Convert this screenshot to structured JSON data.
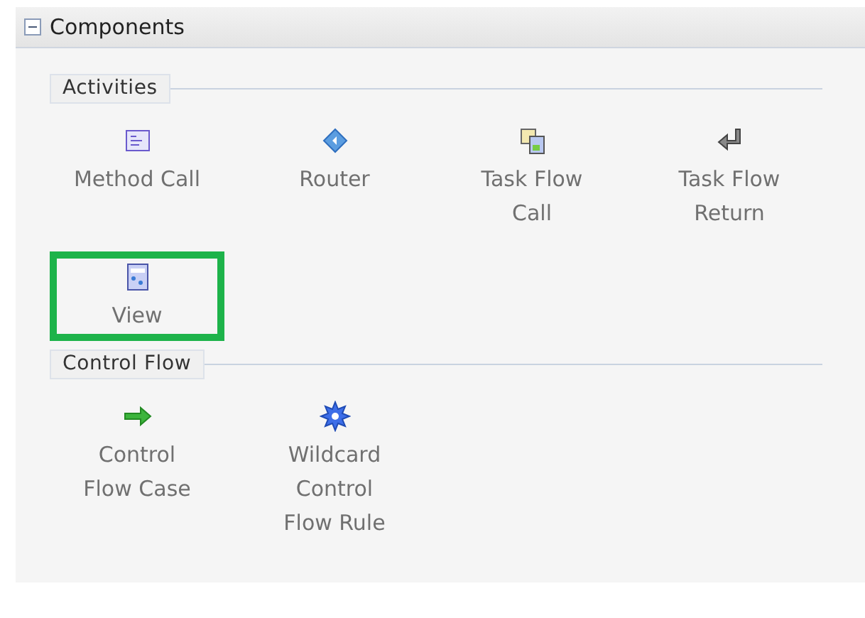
{
  "panel": {
    "title": "Components",
    "expanded": true
  },
  "sections": [
    {
      "title": "Activities",
      "items": [
        {
          "kind": "method",
          "label": [
            "Method Call"
          ],
          "highlighted": false
        },
        {
          "kind": "router",
          "label": [
            "Router"
          ],
          "highlighted": false
        },
        {
          "kind": "taskcall",
          "label": [
            "Task Flow",
            "Call"
          ],
          "highlighted": false
        },
        {
          "kind": "taskreturn",
          "label": [
            "Task Flow",
            "Return"
          ],
          "highlighted": false
        },
        {
          "kind": "view",
          "label": [
            "View"
          ],
          "highlighted": true
        }
      ]
    },
    {
      "title": "Control Flow",
      "items": [
        {
          "kind": "flowcase",
          "label": [
            "Control",
            "Flow Case"
          ],
          "highlighted": false
        },
        {
          "kind": "wildcard",
          "label": [
            "Wildcard",
            "Control",
            "Flow Rule"
          ],
          "highlighted": false
        }
      ]
    }
  ]
}
